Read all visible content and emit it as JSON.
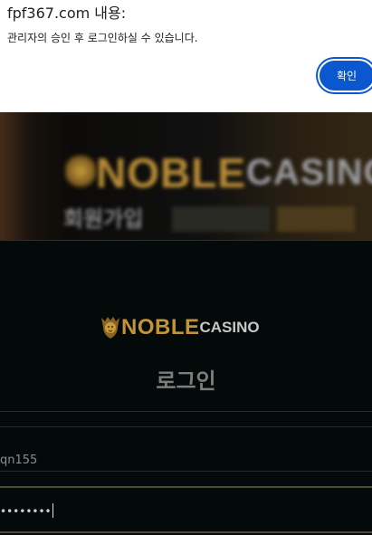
{
  "dialog": {
    "title": "fpf367.com 내용:",
    "message": "관리자의 승인 후 로그인하실 수 있습니다.",
    "confirm_label": "확인",
    "accent_color": "#0b57d0"
  },
  "banner": {
    "logo_noble": "NOBLE",
    "logo_casino": "CASINO",
    "tagline": "회원가입"
  },
  "login": {
    "logo_noble": "NOBLE",
    "logo_casino": "CASINO",
    "heading": "로그인",
    "username_value": "qn155",
    "password_value": "••••••••"
  },
  "icons": {
    "logo_emblem": "lion-crest-icon"
  }
}
